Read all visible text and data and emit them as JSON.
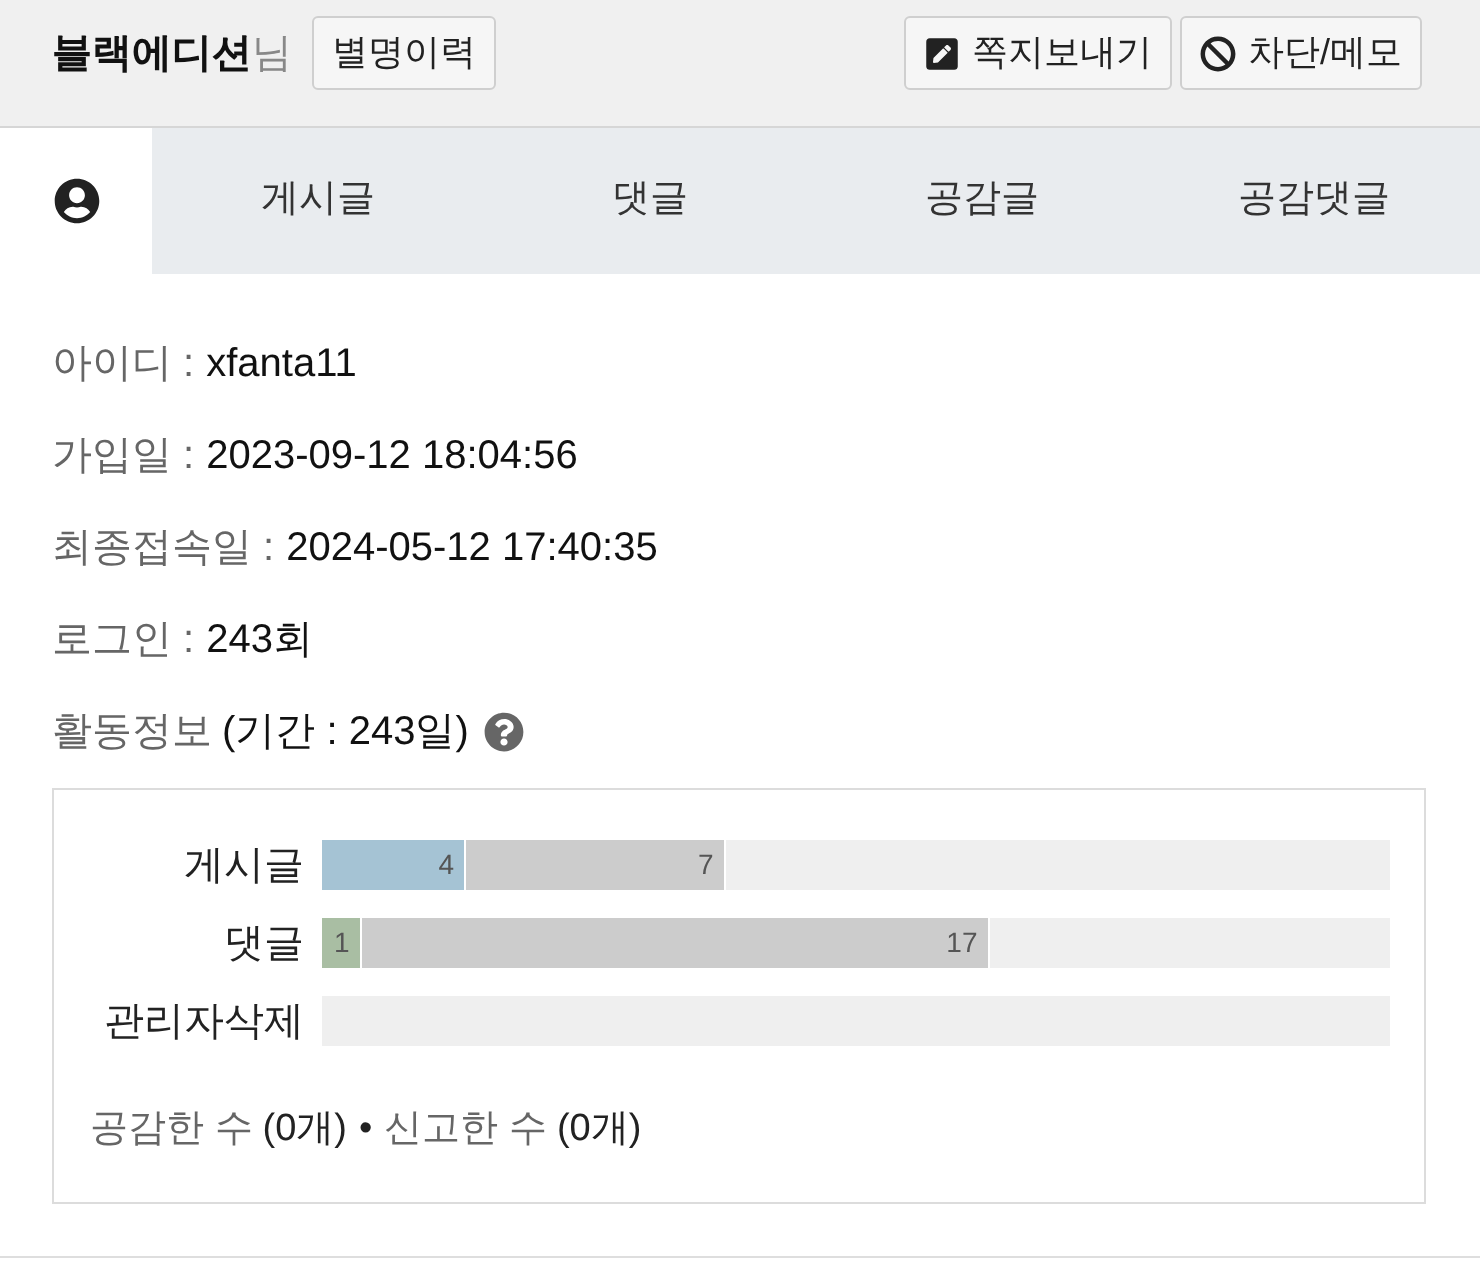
{
  "profile": {
    "nickname": "블랙에디션",
    "suffix": "님",
    "history_button": "별명이력"
  },
  "actions": [
    {
      "kind": "message",
      "label": "쪽지보내기"
    },
    {
      "kind": "block",
      "label": "차단/메모"
    }
  ],
  "tabs": [
    {
      "kind": "icon",
      "selected": true
    },
    {
      "kind": "text",
      "label": "게시글",
      "selected": false
    },
    {
      "kind": "text",
      "label": "댓글",
      "selected": false
    },
    {
      "kind": "text",
      "label": "공감글",
      "selected": false
    },
    {
      "kind": "text",
      "label": "공감댓글",
      "selected": false
    }
  ],
  "info": [
    {
      "label": "아이디 :",
      "value": "xfanta11"
    },
    {
      "label": "가입일 :",
      "value": "2023-09-12 18:04:56"
    },
    {
      "label": "최종접속일 :",
      "value": "2024-05-12 17:40:35"
    },
    {
      "label": "로그인 :",
      "value": "243회"
    }
  ],
  "activity": {
    "label": "활동정보",
    "period": "(기간 : 243일)"
  },
  "stats": {
    "rows": [
      {
        "label": "게시글",
        "segments": [
          {
            "value": "4",
            "level": 0.135,
            "color": "#a5c3d4"
          },
          {
            "value": "7",
            "level": 0.378,
            "color": "#cccccc"
          }
        ]
      },
      {
        "label": "댓글",
        "segments": [
          {
            "value": "1",
            "level": 0.037,
            "color": "#a9bea3"
          },
          {
            "value": "17",
            "level": 0.625,
            "color": "#cccccc"
          }
        ]
      },
      {
        "label": "관리자삭제"
      }
    ],
    "footer": [
      {
        "label": "공감한 수",
        "value": "(0개)"
      },
      {
        "label": "신고한 수",
        "value": "(0개)"
      }
    ],
    "separator": "•"
  }
}
